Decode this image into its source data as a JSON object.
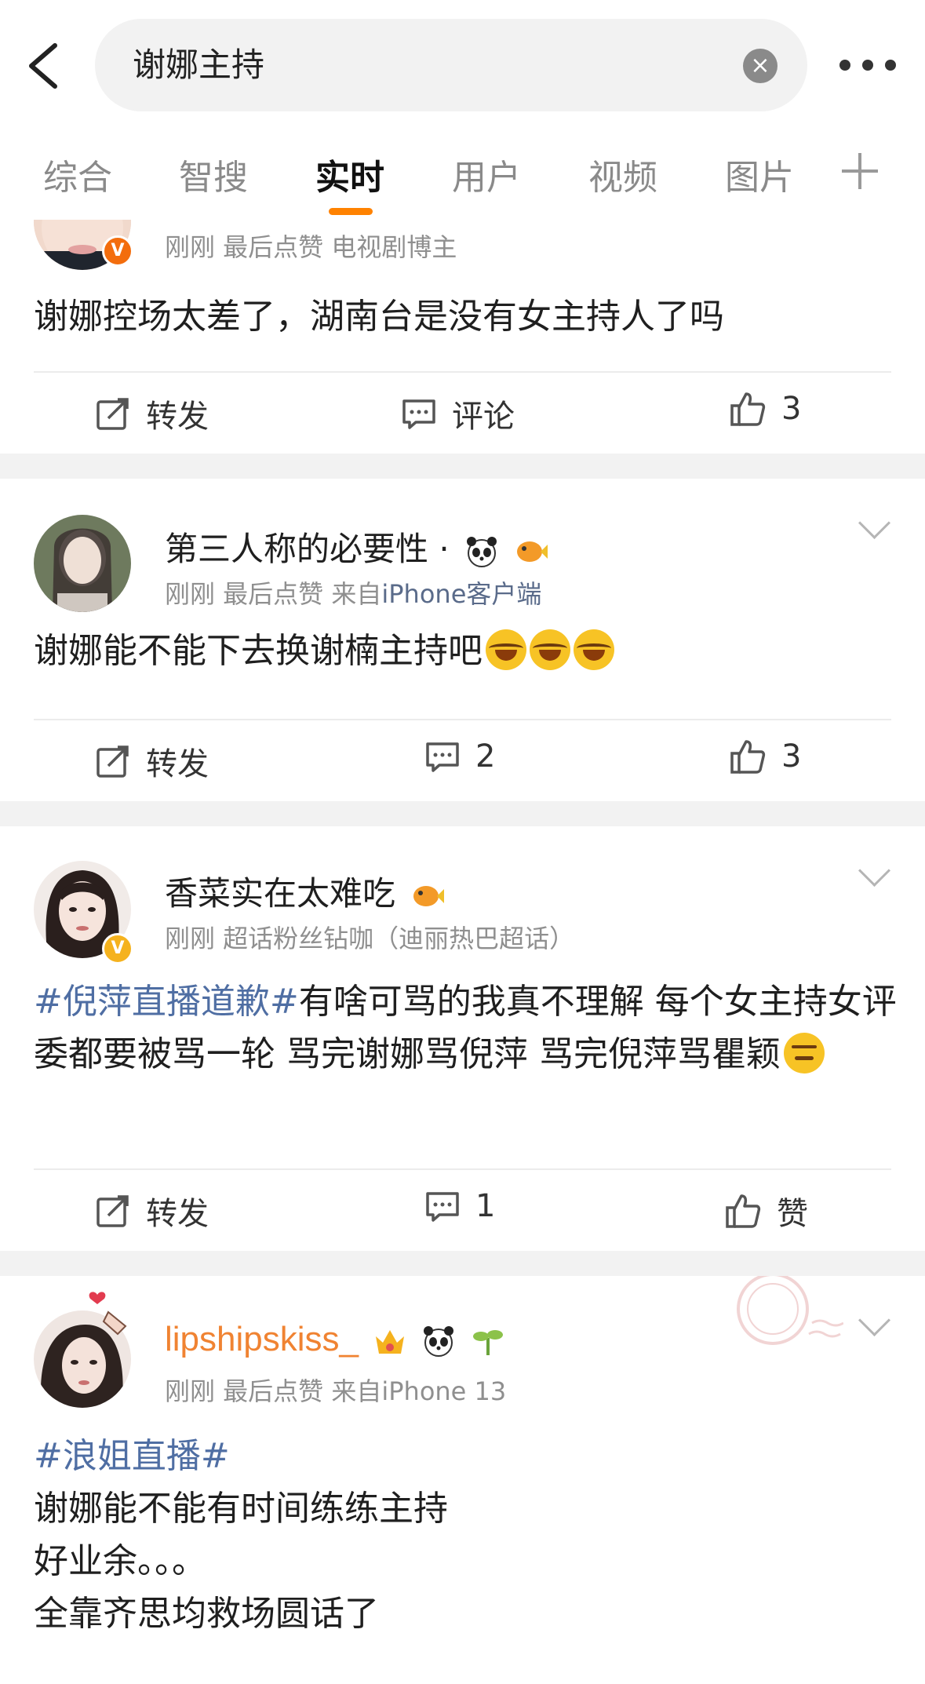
{
  "search": {
    "query": "谢娜主持",
    "clear_glyph": "×"
  },
  "tabs": [
    {
      "label": "综合"
    },
    {
      "label": "智搜"
    },
    {
      "label": "实时",
      "active": true
    },
    {
      "label": "用户"
    },
    {
      "label": "视频"
    },
    {
      "label": "图片"
    }
  ],
  "posts": [
    {
      "meta": "刚刚  最后点赞  电视剧博主",
      "badge": "V",
      "text": "谢娜控场太差了，湖南台是没有女主持人了吗",
      "actions": {
        "repost": "转发",
        "comment": "评论",
        "like": "3"
      }
    },
    {
      "name": "第三人称的必要性 ·",
      "name_icons": [
        "panda-icon",
        "fish-icon"
      ],
      "meta_prefix": "刚刚  最后点赞  来自",
      "meta_source": "iPhone客户端",
      "text": "谢娜能不能下去换谢楠主持吧",
      "emojis": [
        "laugh-cry",
        "laugh-cry",
        "laugh-cry"
      ],
      "actions": {
        "repost": "转发",
        "comment": "2",
        "like": "3"
      }
    },
    {
      "name": "香菜实在太难吃",
      "name_icons": [
        "fish-icon"
      ],
      "badge": "V",
      "meta": "刚刚  超话粉丝钻咖（迪丽热巴超话）",
      "tag": "#倪萍直播道歉#",
      "text": "有啥可骂的我真不理解 每个女主持女评委都要被骂一轮 骂完谢娜骂倪萍 骂完倪萍骂瞿颖",
      "emoji_end": "smirk",
      "actions": {
        "repost": "转发",
        "comment": "1",
        "like": "赞"
      }
    },
    {
      "name": "lipshipskiss_",
      "name_icons": [
        "crown-icon",
        "panda-icon",
        "sprout-icon"
      ],
      "meta": "刚刚  最后点赞  来自iPhone 13",
      "tag": "#浪姐直播#",
      "lines": [
        "谢娜能不能有时间练练主持",
        "好业余。。。",
        "全靠齐思均救场圆话了"
      ]
    }
  ],
  "colors": {
    "accent": "#ff8200",
    "link": "#4f6ea3",
    "meta": "#8f8f8f",
    "name_vip": "#f08332"
  }
}
